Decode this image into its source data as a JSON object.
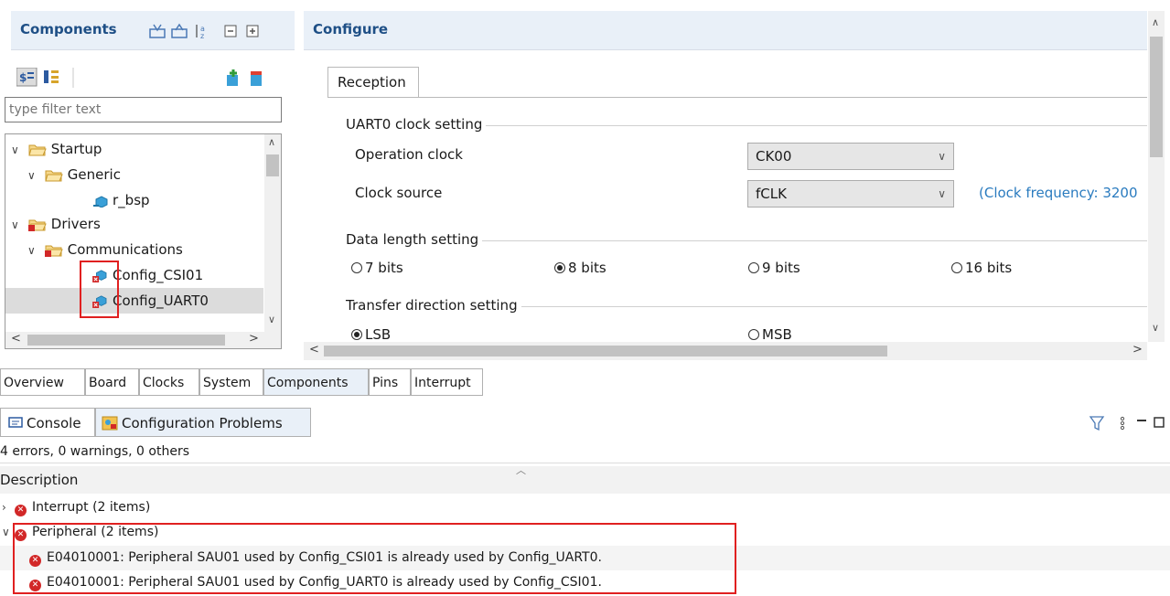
{
  "components_view": {
    "title": "Components",
    "filter_placeholder": "type filter text",
    "tree": [
      {
        "label": "Startup"
      },
      {
        "label": "Generic"
      },
      {
        "label": "r_bsp"
      },
      {
        "label": "Drivers"
      },
      {
        "label": "Communications"
      },
      {
        "label": "Config_CSI01"
      },
      {
        "label": "Config_UART0"
      }
    ]
  },
  "configure_view": {
    "title": "Configure",
    "tab": "Reception",
    "clock_group": {
      "title": "UART0 clock setting",
      "operation_clock_label": "Operation clock",
      "operation_clock_value": "CK00",
      "clock_source_label": "Clock source",
      "clock_source_value": "fCLK",
      "clock_frequency_note": "(Clock frequency: 3200"
    },
    "data_length_group": {
      "title": "Data length setting",
      "options": [
        "7 bits",
        "8 bits",
        "9 bits",
        "16 bits"
      ],
      "selected": "8 bits"
    },
    "direction_group": {
      "title": "Transfer direction setting",
      "options": [
        "LSB",
        "MSB"
      ],
      "selected": "LSB"
    }
  },
  "editor_tabs": [
    "Overview",
    "Board",
    "Clocks",
    "System",
    "Components",
    "Pins",
    "Interrupt"
  ],
  "console": {
    "tabs": [
      "Console",
      "Configuration Problems"
    ],
    "summary": "4 errors, 0 warnings, 0 others",
    "column_header": "Description",
    "groups": [
      {
        "label": "Interrupt (2 items)",
        "expanded": false
      },
      {
        "label": "Peripheral (2 items)",
        "expanded": true
      }
    ],
    "messages": [
      "E04010001: Peripheral SAU01 used by Config_CSI01 is already used by Config_UART0.",
      "E04010001: Peripheral SAU01 used by Config_UART0 is already used by Config_CSI01."
    ]
  },
  "colors": {
    "view_header_bg": "#e9f0f8",
    "view_title": "#1e4f86",
    "error": "#d22828",
    "highlight_box": "#e02020",
    "link": "#2a7bbf"
  }
}
